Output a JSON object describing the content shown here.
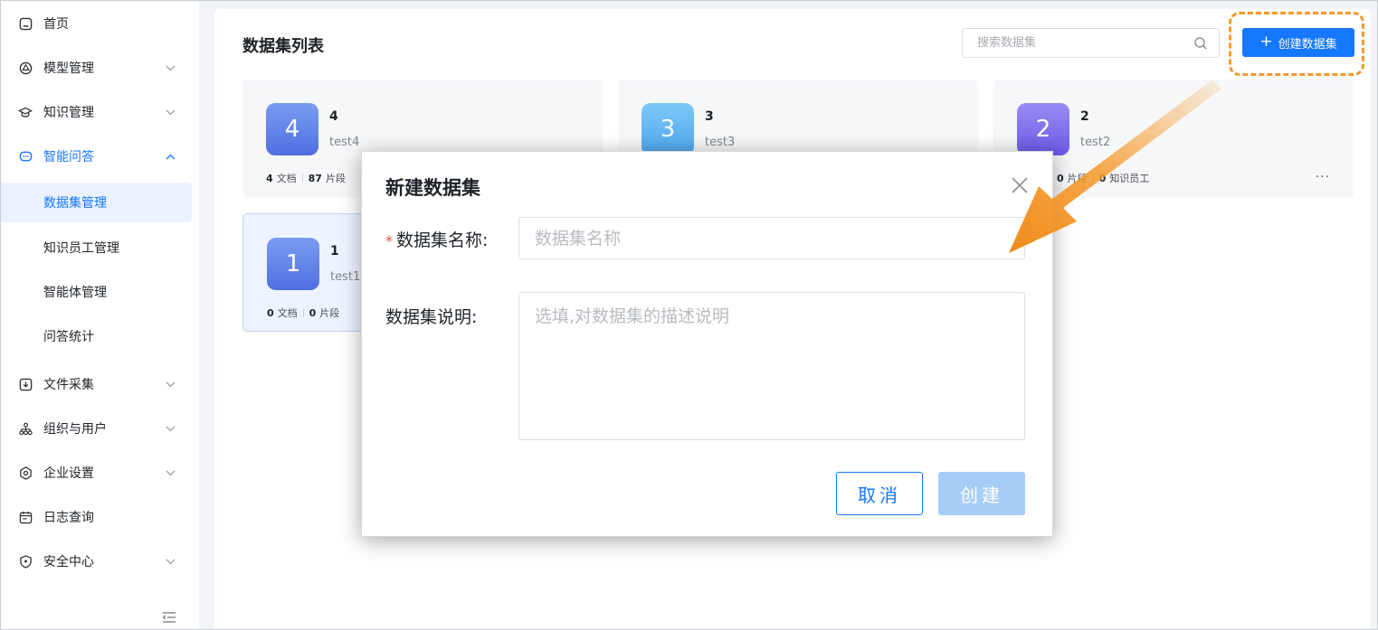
{
  "sidebar": {
    "items": [
      {
        "label": "首页",
        "icon": "home-icon"
      },
      {
        "label": "模型管理",
        "icon": "model-icon"
      },
      {
        "label": "知识管理",
        "icon": "knowledge-icon"
      },
      {
        "label": "智能问答",
        "icon": "chat-icon",
        "expanded": true
      },
      {
        "label": "文件采集",
        "icon": "file-collect-icon"
      },
      {
        "label": "组织与用户",
        "icon": "org-icon"
      },
      {
        "label": "企业设置",
        "icon": "settings-icon"
      },
      {
        "label": "日志查询",
        "icon": "log-icon"
      },
      {
        "label": "安全中心",
        "icon": "shield-icon"
      }
    ],
    "subitems": [
      {
        "label": "数据集管理",
        "selected": true
      },
      {
        "label": "知识员工管理"
      },
      {
        "label": "智能体管理"
      },
      {
        "label": "问答统计"
      }
    ]
  },
  "header": {
    "title": "数据集列表",
    "search_placeholder": "搜索数据集",
    "create_label": "创建数据集"
  },
  "cards": [
    {
      "badge": "4",
      "title": "4",
      "desc": "test4",
      "docs": "4",
      "docs_label": "文档",
      "segments": "87",
      "segments_label": "片段",
      "color_top": "#7b9cf2",
      "color_bottom": "#4f6fe0"
    },
    {
      "badge": "3",
      "title": "3",
      "desc": "test3",
      "color_top": "#7cc8f7",
      "color_bottom": "#4ea6ee"
    },
    {
      "badge": "2",
      "title": "2",
      "desc": "test2",
      "segments": "0",
      "segments_label": "片段",
      "employees": "0",
      "employees_label": "知识员工",
      "color_top": "#9a8cf3",
      "color_bottom": "#6a5ae6"
    },
    {
      "badge": "1",
      "title": "1",
      "desc": "test1",
      "docs": "0",
      "docs_label": "文档",
      "segments": "0",
      "segments_label": "片段",
      "color_top": "#7b9cf2",
      "color_bottom": "#4f6fe0"
    }
  ],
  "more_symbol": "···",
  "modal": {
    "title": "新建数据集",
    "name_label": "数据集名称:",
    "name_required_mark": "*",
    "name_placeholder": "数据集名称",
    "desc_label": "数据集说明:",
    "desc_placeholder": "选填,对数据集的描述说明",
    "cancel_label": "取消",
    "create_label": "创建"
  },
  "colors": {
    "accent": "#1677ff",
    "highlight": "#f59a2b",
    "required": "#e34d4d"
  }
}
